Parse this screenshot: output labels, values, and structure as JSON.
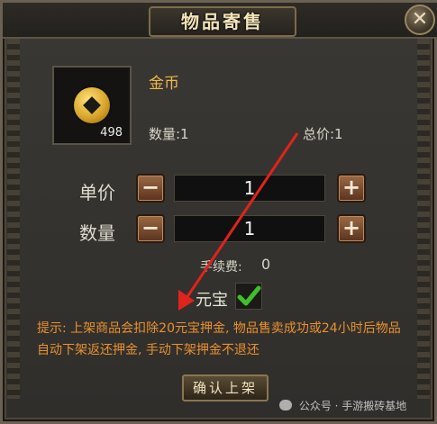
{
  "window": {
    "title": "物品寄售",
    "close_symbol": "✕"
  },
  "item": {
    "name": "金币",
    "count": "498",
    "icon": "coin-icon"
  },
  "info": {
    "quantity": "数量:1",
    "total_price": "总价:1"
  },
  "unit_price": {
    "label": "单价",
    "value": "1",
    "minus": "−",
    "plus": "+"
  },
  "amount": {
    "label": "数量",
    "value": "1",
    "minus": "−",
    "plus": "+"
  },
  "fee": {
    "label": "手续费:",
    "value": "0"
  },
  "currency": {
    "label": "元宝",
    "checked": true,
    "check_color": "#3fbf2a"
  },
  "tip": "提示: 上架商品会扣除20元宝押金, 物品售卖成功或24小时后物品自动下架返还押金, 手动下架押金不退还",
  "confirm_button": "确认上架",
  "watermark": "公众号 · 手游搬砖基地",
  "annotation": {
    "arrow_color": "#e0231c"
  }
}
